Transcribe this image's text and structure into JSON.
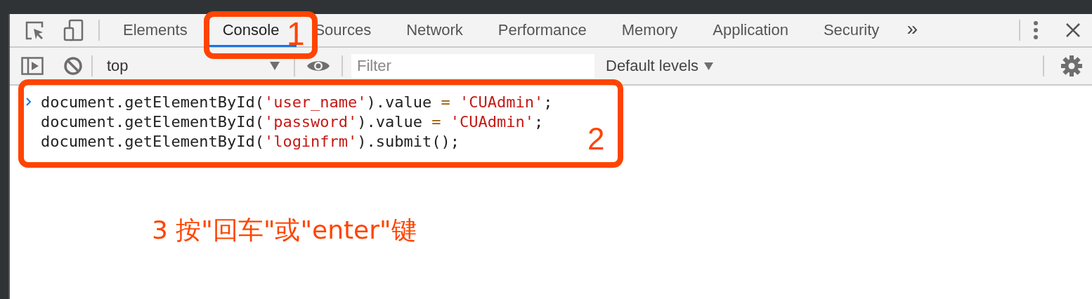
{
  "tabs": [
    {
      "label": "Elements",
      "selected": false
    },
    {
      "label": "Console",
      "selected": true
    },
    {
      "label": "Sources",
      "selected": false
    },
    {
      "label": "Network",
      "selected": false
    },
    {
      "label": "Performance",
      "selected": false
    },
    {
      "label": "Memory",
      "selected": false
    },
    {
      "label": "Application",
      "selected": false
    },
    {
      "label": "Security",
      "selected": false
    }
  ],
  "more_tabs": "»",
  "toolbar": {
    "context": "top",
    "filter": {
      "placeholder": "Filter"
    },
    "levels": "Default levels"
  },
  "console_input": [
    [
      {
        "kind": "plain",
        "text": "document.getElementById("
      },
      {
        "kind": "string",
        "text": "'user_name'"
      },
      {
        "kind": "plain",
        "text": ").value"
      },
      {
        "kind": "operator",
        "text": " = "
      },
      {
        "kind": "string",
        "text": "'CUAdmin'"
      },
      {
        "kind": "plain",
        "text": ";"
      }
    ],
    [
      {
        "kind": "plain",
        "text": "document.getElementById("
      },
      {
        "kind": "string",
        "text": "'password'"
      },
      {
        "kind": "plain",
        "text": ").value"
      },
      {
        "kind": "operator",
        "text": " = "
      },
      {
        "kind": "string",
        "text": "'CUAdmin'"
      },
      {
        "kind": "plain",
        "text": ";"
      }
    ],
    [
      {
        "kind": "plain",
        "text": "document.getElementById("
      },
      {
        "kind": "string",
        "text": "'loginfrm'"
      },
      {
        "kind": "plain",
        "text": ").submit();"
      }
    ]
  ],
  "annotations": [
    {
      "kind": "box",
      "label": "1"
    },
    {
      "kind": "box",
      "label": "2"
    },
    {
      "kind": "note",
      "label": "3 按\"回车\"或\"enter\"键"
    }
  ]
}
